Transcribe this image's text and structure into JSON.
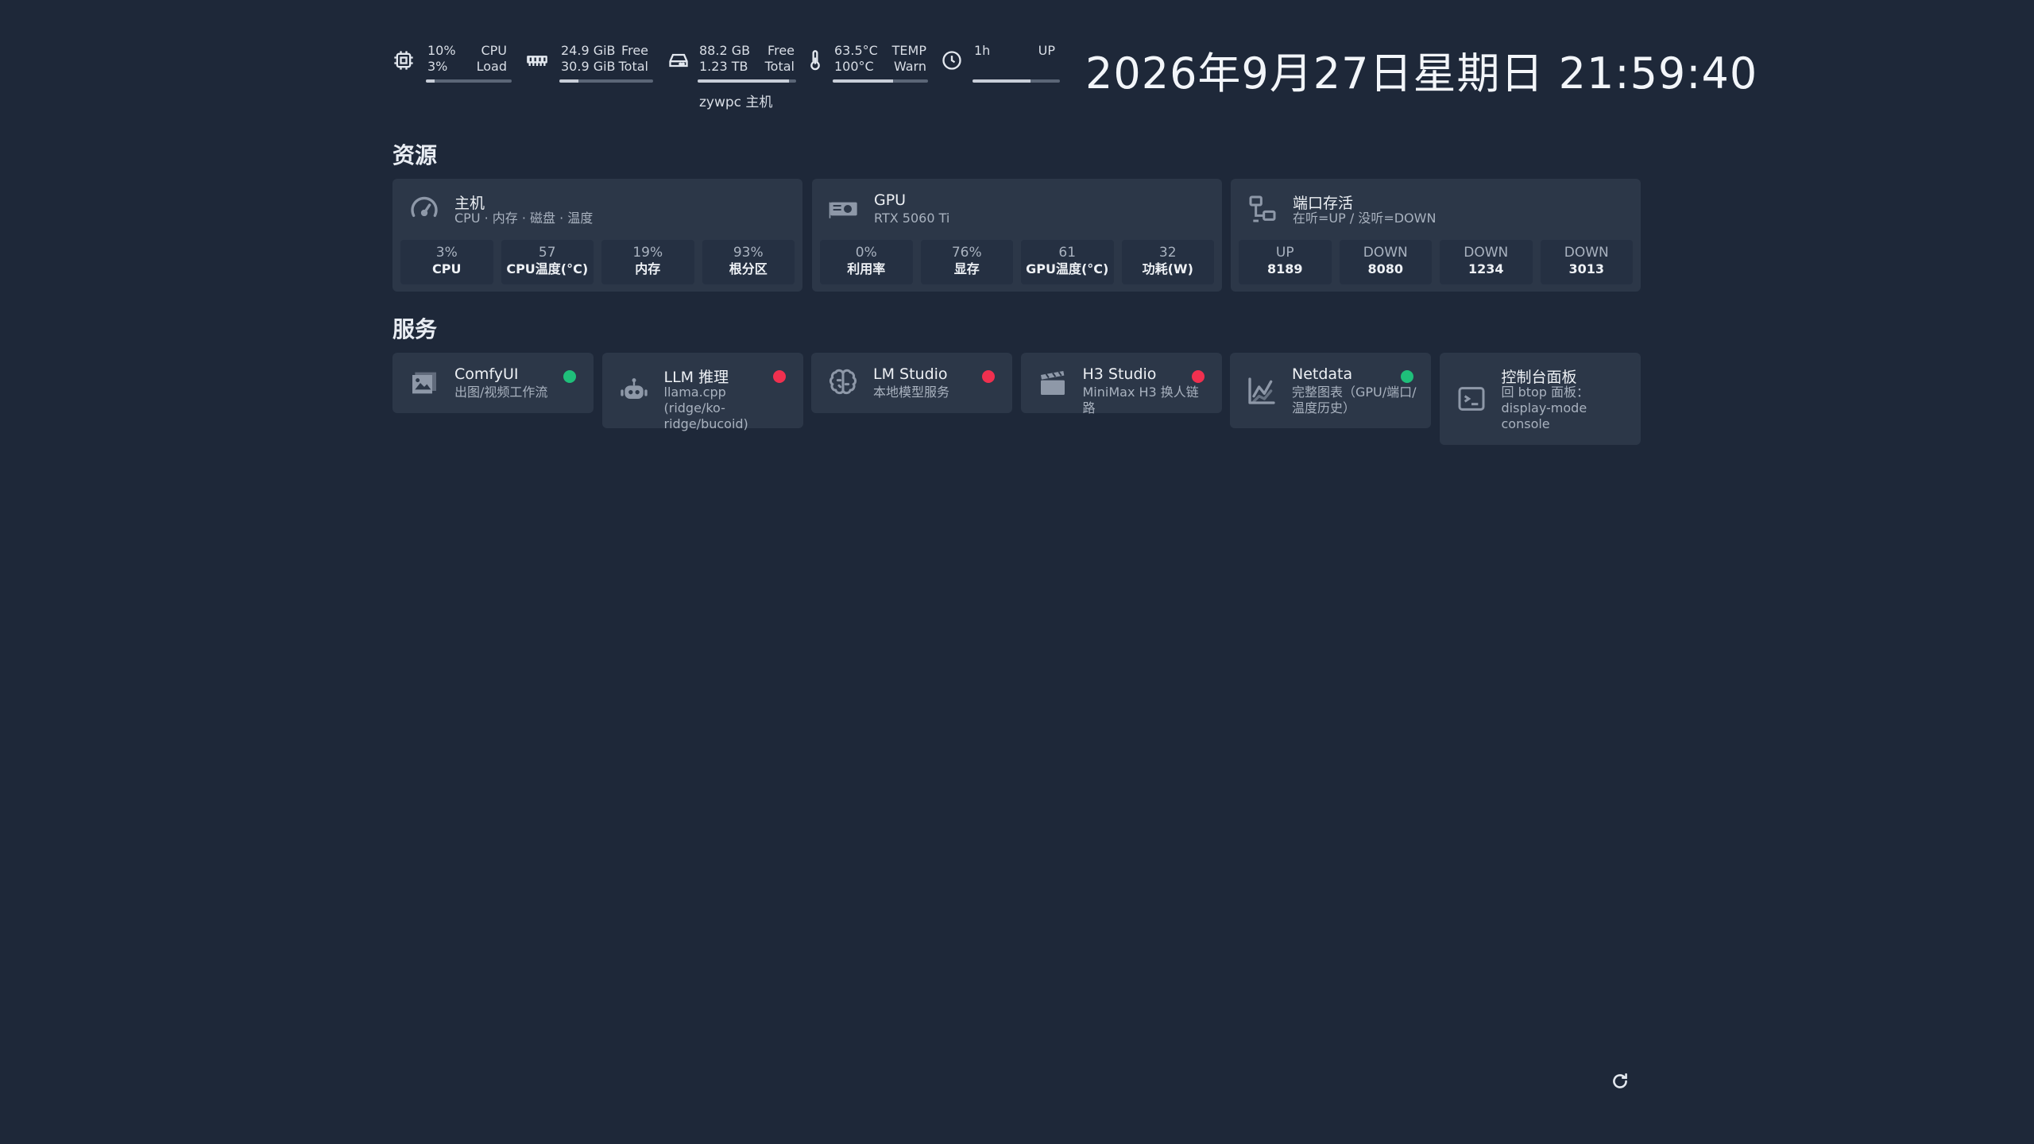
{
  "top": {
    "cpu": {
      "v1": "10%",
      "v2": "3%",
      "l1": "CPU",
      "l2": "Load",
      "progress": 0.1
    },
    "ram": {
      "v1": "24.9 GiB",
      "v2": "30.9 GiB",
      "l1": "Free",
      "l2": "Total",
      "progress": 0.2
    },
    "disk": {
      "v1": "88.2 GB",
      "v2": "1.23 TB",
      "l1": "Free",
      "l2": "Total",
      "progress": 0.93
    },
    "temp": {
      "v1": "63.5°C",
      "v2": "100°C",
      "l1": "TEMP",
      "l2": "Warn",
      "progress": 0.63
    },
    "uptime": {
      "v1": "1h",
      "l1": "UP",
      "progress": 0.66
    },
    "hostname": "zywpc 主机"
  },
  "clock": "2026年9月27日星期日 21:59:40",
  "sections": {
    "resources": "资源",
    "services": "服务"
  },
  "resources": [
    {
      "title": "主机",
      "subtitle": "CPU · 内存 · 磁盘 · 温度",
      "icon": "speedometer-icon",
      "stats": [
        {
          "value": "3%",
          "label": "CPU"
        },
        {
          "value": "57",
          "label": "CPU温度(°C)"
        },
        {
          "value": "19%",
          "label": "内存"
        },
        {
          "value": "93%",
          "label": "根分区"
        }
      ]
    },
    {
      "title": "GPU",
      "subtitle": "RTX 5060 Ti",
      "icon": "gpu-card-icon",
      "stats": [
        {
          "value": "0%",
          "label": "利用率"
        },
        {
          "value": "76%",
          "label": "显存"
        },
        {
          "value": "61",
          "label": "GPU温度(°C)"
        },
        {
          "value": "32",
          "label": "功耗(W)"
        }
      ]
    },
    {
      "title": "端口存活",
      "subtitle": "在听=UP / 没听=DOWN",
      "icon": "network-icon",
      "stats": [
        {
          "value": "UP",
          "label": "8189"
        },
        {
          "value": "DOWN",
          "label": "8080"
        },
        {
          "value": "DOWN",
          "label": "1234"
        },
        {
          "value": "DOWN",
          "label": "3013"
        }
      ]
    }
  ],
  "services": [
    {
      "title": "ComfyUI",
      "subtitle": "出图/视频工作流",
      "status": "up",
      "icon": "image-icon"
    },
    {
      "title": "LLM 推理",
      "subtitle": "llama.cpp (ridge/ko-ridge/bucoid)",
      "status": "down",
      "icon": "robot-icon"
    },
    {
      "title": "LM Studio",
      "subtitle": "本地模型服务",
      "status": "down",
      "icon": "brain-icon"
    },
    {
      "title": "H3 Studio",
      "subtitle": "MiniMax H3 换人链路",
      "status": "down",
      "icon": "clapperboard-icon"
    },
    {
      "title": "Netdata",
      "subtitle": "完整图表（GPU/端口/温度历史）",
      "status": "up",
      "icon": "chart-line-icon"
    },
    {
      "title": "控制台面板",
      "subtitle": "回 btop 面板：display-mode console",
      "status": "none",
      "icon": "terminal-icon"
    }
  ],
  "colors": {
    "up": "#1fbf7a",
    "down": "#f0304f",
    "bg": "#1e2839",
    "card": "#2c3748"
  }
}
